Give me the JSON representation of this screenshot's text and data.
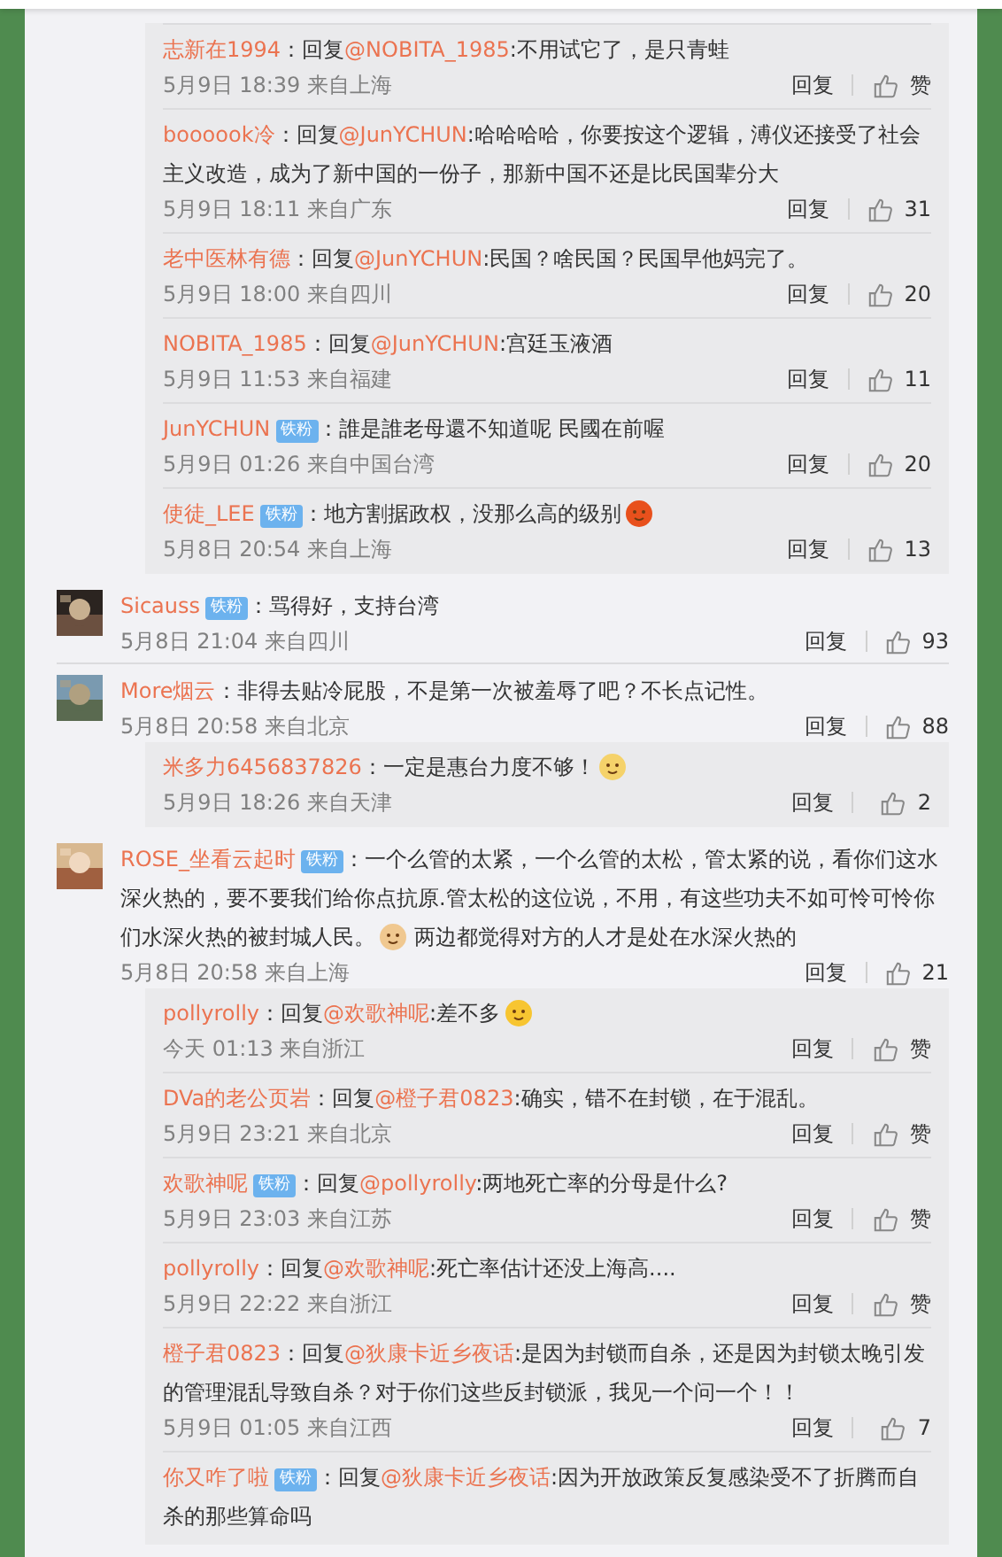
{
  "threads": [
    {
      "replies": [
        {
          "name": "志新在1994",
          "colon": "：",
          "prefix": "回复",
          "reply_to": "@NOBITA_1985",
          "text": ":不用试它了，是只青蛙",
          "time": "5月9日 18:39 来自上海",
          "reply_label": "回复",
          "likes": "赞"
        },
        {
          "name": "boooook冷",
          "colon": "：",
          "prefix": "回复",
          "reply_to": "@JunYCHUN",
          "text": ":哈哈哈哈，你要按这个逻辑，溥仪还接受了社会主义改造，成为了新中国的一份子，那新中国不还是比民国辈分大",
          "time": "5月9日 18:11 来自广东",
          "reply_label": "回复",
          "likes": "31"
        },
        {
          "name": "老中医林有德",
          "colon": "：",
          "prefix": "回复",
          "reply_to": "@JunYCHUN",
          "text": ":民国？啥民国？民国早他妈完了。",
          "time": "5月9日 18:00 来自四川",
          "reply_label": "回复",
          "likes": "20"
        },
        {
          "name": "NOBITA_1985",
          "colon": "：",
          "prefix": "回复",
          "reply_to": "@JunYCHUN",
          "text": ":宫廷玉液酒",
          "time": "5月9日 11:53 来自福建",
          "reply_label": "回复",
          "likes": "11"
        },
        {
          "name": "JunYCHUN",
          "badge": "铁粉",
          "colon": "：",
          "text": "誰是誰老母還不知道呢 民國在前喔",
          "time": "5月9日 01:26 来自中国台湾",
          "reply_label": "回复",
          "likes": "20"
        },
        {
          "name": "使徒_LEE",
          "badge": "铁粉",
          "colon": "：",
          "text": "地方割据政权，没那么高的级别",
          "emoji": {
            "color": "#e8501c"
          },
          "time": "5月8日 20:54 来自上海",
          "reply_label": "回复",
          "likes": "13"
        }
      ]
    },
    {
      "comment": {
        "name": "Sicauss",
        "badge": "铁粉",
        "colon": "：",
        "text": "骂得好，支持台湾",
        "time": "5月8日 21:04 来自四川",
        "reply_label": "回复",
        "likes": "93"
      }
    },
    {
      "comment": {
        "name": "More烟云",
        "colon": "：",
        "text": "非得去贴冷屁股，不是第一次被羞辱了吧？不长点记性。",
        "time": "5月8日 20:58 来自北京",
        "reply_label": "回复",
        "likes": "88"
      },
      "replies": [
        {
          "name": "米多力6456837826",
          "colon": "：",
          "text": "一定是惠台力度不够！",
          "emoji": {
            "color": "#f5d26a"
          },
          "time": "5月9日 18:26 来自天津",
          "reply_label": "回复",
          "likes": "2"
        }
      ]
    },
    {
      "comment": {
        "name": "ROSE_坐看云起时",
        "badge": "铁粉",
        "colon": "：",
        "text": "一个么管的太紧，一个么管的太松，管太紧的说，看你们这水深火热的，要不要我们给你点抗原.管太松的这位说，不用，有这些功夫不如可怜可怜你们水深火热的被封城人民。",
        "emoji": {
          "color": "#f0c890"
        },
        "text_after": "两边都觉得对方的人才是处在水深火热的",
        "time": "5月8日 20:58 来自上海",
        "reply_label": "回复",
        "likes": "21"
      },
      "replies": [
        {
          "name": "pollyrolly",
          "colon": "：",
          "prefix": "回复",
          "reply_to": "@欢歌神呢",
          "text": ":差不多",
          "emoji": {
            "color": "#f7c531"
          },
          "time": "今天 01:13 来自浙江",
          "reply_label": "回复",
          "likes": "赞"
        },
        {
          "name": "DVa的老公页岩",
          "colon": "：",
          "prefix": "回复",
          "reply_to": "@橙子君0823",
          "text": ":确实，错不在封锁，在于混乱。",
          "time": "5月9日 23:21 来自北京",
          "reply_label": "回复",
          "likes": "赞"
        },
        {
          "name": "欢歌神呢",
          "badge": "铁粉",
          "colon": "：",
          "prefix": "回复",
          "reply_to": "@pollyrolly",
          "text": ":两地死亡率的分母是什么?",
          "time": "5月9日 23:03 来自江苏",
          "reply_label": "回复",
          "likes": "赞"
        },
        {
          "name": "pollyrolly",
          "colon": "：",
          "prefix": "回复",
          "reply_to": "@欢歌神呢",
          "text": ":死亡率估计还没上海高....",
          "time": "5月9日 22:22 来自浙江",
          "reply_label": "回复",
          "likes": "赞"
        },
        {
          "name": "橙子君0823",
          "colon": "：",
          "prefix": "回复",
          "reply_to": "@狄康卡近乡夜话",
          "text": ":是因为封锁而自杀，还是因为封锁太晚引发的管理混乱导致自杀？对于你们这些反封锁派，我见一个问一个！！",
          "time": "5月9日 01:05 来自江西",
          "reply_label": "回复",
          "likes": "7"
        },
        {
          "name": "你又咋了啦",
          "badge": "铁粉",
          "colon": "：",
          "prefix": "回复",
          "reply_to": "@狄康卡近乡夜话",
          "text": ":因为开放政策反复感染受不了折腾而自杀的那些算命吗"
        }
      ]
    }
  ]
}
